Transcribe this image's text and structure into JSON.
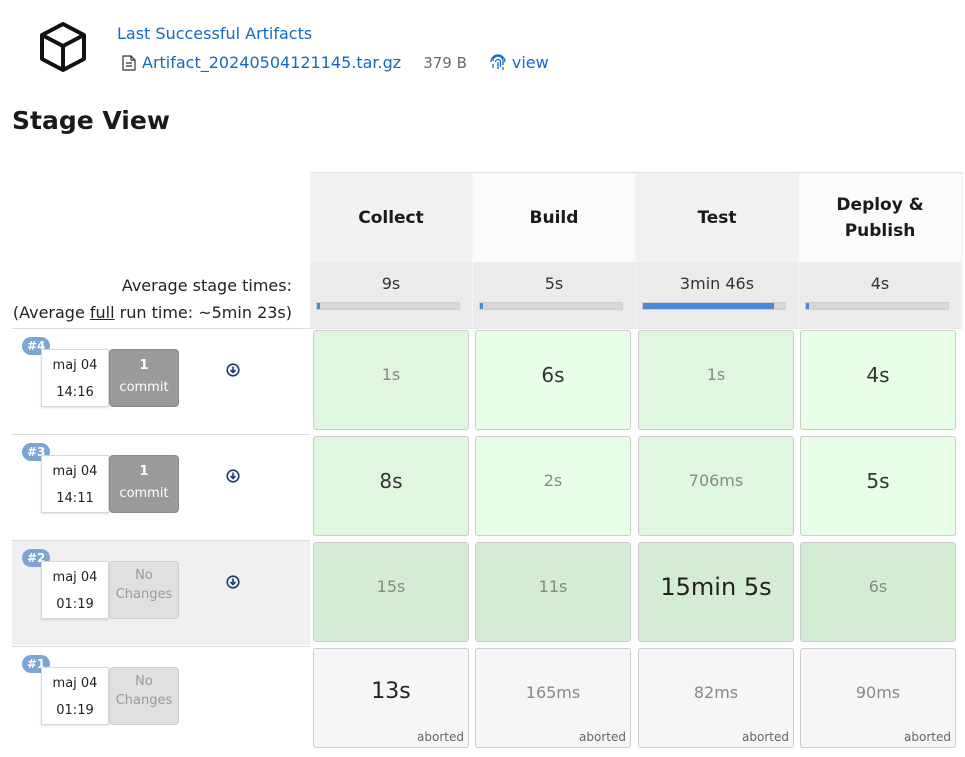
{
  "artifacts": {
    "title": "Last Successful Artifacts",
    "file_name": "Artifact_20240504121145.tar.gz",
    "file_size": "379 B",
    "view_label": "view",
    "icons": [
      "package-box-icon",
      "file-icon",
      "fingerprint-icon"
    ]
  },
  "stage_view": {
    "title": "Stage View",
    "stages": [
      "Collect",
      "Build",
      "Test",
      "Deploy &\nPublish"
    ],
    "average": {
      "label": "Average stage times:",
      "full_prefix": "(Average ",
      "full_word": "full",
      "full_suffix": " run time: ~5min 23s)",
      "times": [
        "9s",
        "5s",
        "3min 46s",
        "4s"
      ],
      "progress": [
        0.02,
        0.02,
        0.92,
        0.02
      ]
    },
    "runs": [
      {
        "id": "#4",
        "day": "maj 04",
        "time": "14:16",
        "changes": {
          "count": "1",
          "label": "commit"
        },
        "has_download": true,
        "cells": [
          {
            "time": "1s",
            "status": ""
          },
          {
            "time": "6s",
            "status": ""
          },
          {
            "time": "1s",
            "status": ""
          },
          {
            "time": "4s",
            "status": ""
          }
        ]
      },
      {
        "id": "#3",
        "day": "maj 04",
        "time": "14:11",
        "changes": {
          "count": "1",
          "label": "commit"
        },
        "has_download": true,
        "cells": [
          {
            "time": "8s",
            "status": ""
          },
          {
            "time": "2s",
            "status": ""
          },
          {
            "time": "706ms",
            "status": ""
          },
          {
            "time": "5s",
            "status": ""
          }
        ]
      },
      {
        "id": "#2",
        "day": "maj 04",
        "time": "01:19",
        "changes": {
          "line1": "No",
          "line2": "Changes"
        },
        "has_download": true,
        "cells": [
          {
            "time": "15s",
            "status": ""
          },
          {
            "time": "11s",
            "status": ""
          },
          {
            "time": "15min 5s",
            "status": ""
          },
          {
            "time": "6s",
            "status": ""
          }
        ]
      },
      {
        "id": "#1",
        "day": "maj 04",
        "time": "01:19",
        "changes": {
          "line1": "No",
          "line2": "Changes"
        },
        "has_download": false,
        "cells": [
          {
            "time": "13s",
            "status": "aborted"
          },
          {
            "time": "165ms",
            "status": "aborted"
          },
          {
            "time": "82ms",
            "status": "aborted"
          },
          {
            "time": "90ms",
            "status": "aborted"
          }
        ]
      }
    ]
  },
  "colors": {
    "link": "#1469c7",
    "success_cell": "#dff7df",
    "aborted_cell": "#f6f6f6",
    "badge": "#7ea4d4",
    "progress": "#4d87d9"
  }
}
